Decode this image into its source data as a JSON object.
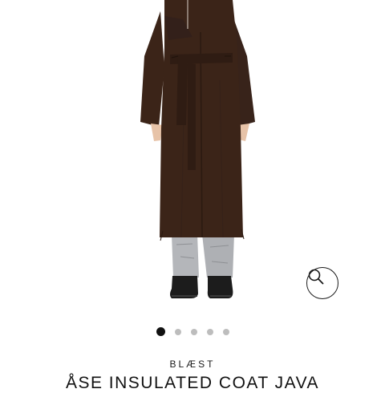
{
  "product": {
    "brand": "BLÆST",
    "title": "ÅSE INSULATED COAT JAVA"
  },
  "gallery": {
    "image_count": 5,
    "active_index": 0,
    "zoom_icon": "magnifier-icon"
  },
  "colors": {
    "coat": "#3b2418",
    "dot_active": "#111111",
    "dot_inactive": "#bdbdbd"
  }
}
